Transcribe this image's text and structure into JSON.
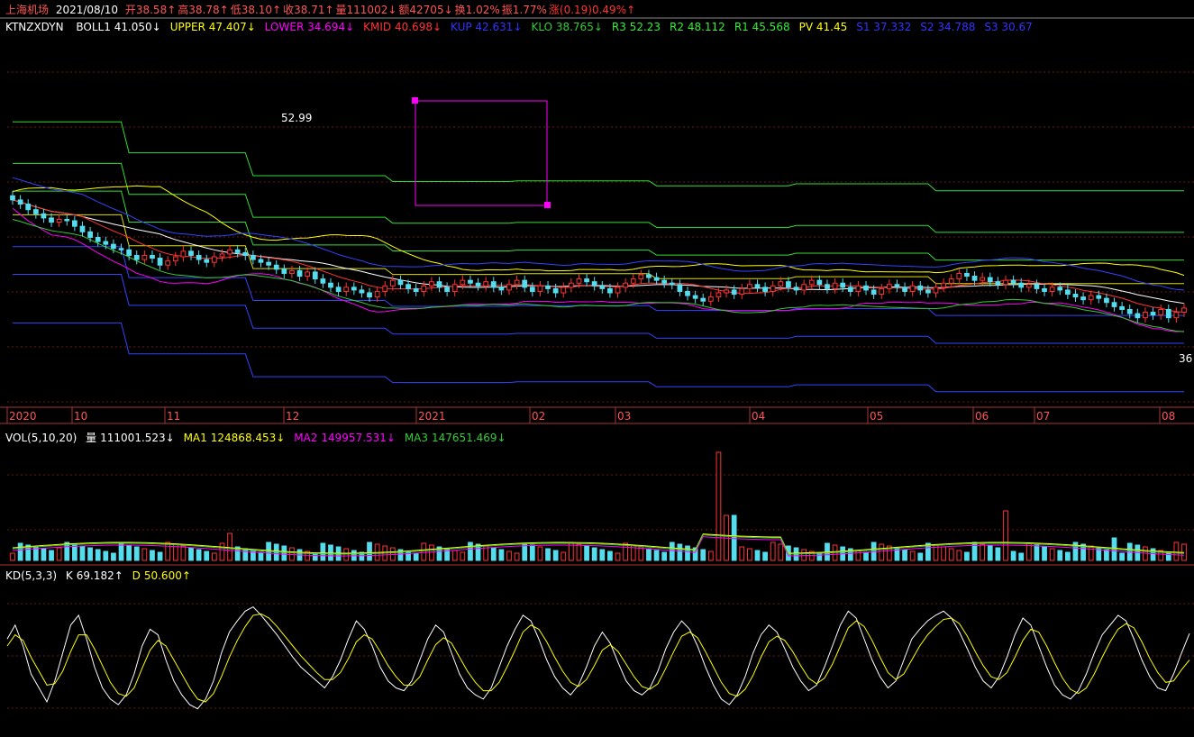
{
  "header": {
    "stock_name": "上海机场",
    "date": "2021/08/10",
    "fields": [
      {
        "text": "开38.58↑",
        "color": "#ff5555"
      },
      {
        "text": "高38.78↑",
        "color": "#ff5555"
      },
      {
        "text": "低38.10↑",
        "color": "#ff5555"
      },
      {
        "text": "收38.71↑",
        "color": "#ff5555"
      },
      {
        "text": "量111002↓",
        "color": "#ff5555"
      },
      {
        "text": "额42705↓",
        "color": "#ff5555"
      },
      {
        "text": "换1.02%",
        "color": "#ff5555"
      },
      {
        "text": "振1.77%",
        "color": "#ff5555"
      },
      {
        "text": "涨(0.19)0.49%↑",
        "color": "#ff3333"
      }
    ]
  },
  "indicator_line": {
    "name": "KTNZXDYN",
    "items": [
      {
        "text": "BOLL1 41.050↓",
        "color": "#ffffff"
      },
      {
        "text": "UPPER 47.407↓",
        "color": "#ffff00"
      },
      {
        "text": "LOWER 34.694↓",
        "color": "#ff00ff"
      },
      {
        "text": "KMID 40.698↓",
        "color": "#ff3333"
      },
      {
        "text": "KUP 42.631↓",
        "color": "#3333ff"
      },
      {
        "text": "KLO 38.765↓",
        "color": "#33cc33"
      },
      {
        "text": "R3 52.23",
        "color": "#33ee33"
      },
      {
        "text": "R2 48.112",
        "color": "#33ee33"
      },
      {
        "text": "R1 45.568",
        "color": "#33ee33"
      },
      {
        "text": "PV 41.45",
        "color": "#ffff00"
      },
      {
        "text": "S1 37.332",
        "color": "#3333ff"
      },
      {
        "text": "S2 34.788",
        "color": "#3333ff"
      },
      {
        "text": "S3 30.67",
        "color": "#3333ff"
      }
    ]
  },
  "chart_data": [
    {
      "type": "candlestick",
      "title": "上海机场",
      "annotations": [
        {
          "text": "52.99",
          "x": "2020-11"
        },
        {
          "text": "36",
          "x": "2021-08"
        }
      ],
      "x_labels": [
        "2020",
        "10",
        "11",
        "12",
        "2021",
        "02",
        "03",
        "04",
        "05",
        "06",
        "07",
        "08"
      ],
      "closes": [
        44.5,
        44.2,
        43.8,
        43.5,
        43.2,
        42.9,
        43.1,
        43.0,
        42.6,
        42.2,
        41.8,
        41.5,
        41.3,
        41.0,
        40.9,
        40.5,
        40.2,
        40.5,
        40.3,
        39.8,
        40.1,
        40.4,
        40.8,
        40.5,
        40.2,
        40.0,
        40.4,
        40.6,
        40.9,
        40.7,
        40.5,
        40.2,
        40.0,
        39.8,
        39.5,
        39.2,
        39.4,
        39.0,
        39.3,
        38.8,
        38.5,
        38.2,
        37.9,
        38.2,
        38.0,
        37.8,
        37.5,
        37.9,
        38.3,
        38.7,
        38.4,
        38.1,
        37.9,
        38.3,
        38.6,
        38.2,
        37.9,
        38.4,
        38.7,
        38.5,
        38.3,
        38.6,
        38.2,
        38.0,
        38.4,
        38.7,
        38.2,
        37.9,
        38.3,
        38.1,
        37.8,
        38.2,
        38.5,
        38.8,
        38.6,
        38.3,
        38.1,
        37.8,
        38.2,
        38.5,
        38.8,
        39.1,
        38.9,
        38.7,
        38.5,
        38.4,
        37.9,
        37.6,
        37.4,
        37.2,
        37.5,
        37.8,
        38.0,
        37.7,
        38.1,
        38.4,
        38.2,
        37.9,
        38.3,
        38.6,
        38.2,
        38.0,
        38.4,
        38.7,
        38.4,
        38.1,
        38.5,
        38.2,
        37.9,
        38.3,
        38.0,
        37.7,
        38.1,
        38.4,
        38.2,
        37.9,
        38.3,
        38.0,
        37.8,
        38.2,
        38.5,
        38.8,
        39.2,
        39.0,
        38.7,
        38.9,
        38.6,
        38.4,
        38.7,
        38.5,
        38.2,
        38.4,
        38.1,
        37.9,
        38.2,
        38.0,
        37.7,
        37.5,
        37.3,
        37.6,
        37.4,
        37.1,
        36.8,
        36.6,
        36.3,
        36.0,
        36.4,
        36.2,
        36.6,
        36.0,
        36.4,
        36.7
      ],
      "kline_points": "",
      "volume": {
        "label": "量",
        "value": "111001.523↓"
      }
    },
    {
      "type": "bar",
      "title": "VOL(5,10,20)",
      "series": [
        {
          "name": "量",
          "value": "111001.523↓"
        },
        {
          "name": "MA1",
          "value": "124868.453↓"
        },
        {
          "name": "MA2",
          "value": "149957.531↓"
        },
        {
          "name": "MA3",
          "value": "147651.469↓"
        }
      ]
    },
    {
      "type": "line",
      "title": "KD(5,3,3)",
      "series": [
        {
          "name": "K",
          "value": "69.182↑"
        },
        {
          "name": "D",
          "value": "50.600↑"
        }
      ],
      "ylim": [
        0,
        100
      ],
      "k_values": [
        65,
        75,
        60,
        40,
        30,
        20,
        35,
        55,
        75,
        82,
        65,
        45,
        30,
        22,
        18,
        25,
        40,
        60,
        72,
        68,
        50,
        35,
        25,
        18,
        15,
        22,
        35,
        55,
        70,
        78,
        85,
        88,
        82,
        75,
        68,
        60,
        52,
        45,
        40,
        35,
        30,
        38,
        50,
        65,
        78,
        72,
        60,
        45,
        35,
        30,
        28,
        35,
        50,
        65,
        75,
        70,
        55,
        40,
        30,
        25,
        22,
        30,
        45,
        60,
        72,
        82,
        78,
        65,
        50,
        38,
        30,
        25,
        32,
        45,
        60,
        70,
        62,
        48,
        35,
        28,
        25,
        30,
        42,
        58,
        70,
        78,
        72,
        60,
        45,
        32,
        22,
        18,
        25,
        38,
        55,
        68,
        75,
        70,
        58,
        45,
        35,
        28,
        32,
        45,
        60,
        75,
        85,
        80,
        65,
        50,
        38,
        30,
        35,
        50,
        65,
        72,
        78,
        82,
        85,
        80,
        70,
        58,
        45,
        35,
        30,
        38,
        52,
        68,
        80,
        75,
        60,
        45,
        32,
        25,
        22,
        28,
        40,
        55,
        68,
        75,
        82,
        78,
        65,
        50,
        38,
        30,
        28,
        40,
        55,
        69
      ],
      "d_values": [
        60,
        68,
        64,
        52,
        42,
        32,
        33,
        42,
        56,
        68,
        68,
        58,
        46,
        34,
        26,
        24,
        30,
        44,
        57,
        64,
        60,
        50,
        40,
        30,
        22,
        20,
        26,
        38,
        52,
        64,
        74,
        82,
        83,
        80,
        74,
        67,
        60,
        53,
        47,
        41,
        36,
        36,
        41,
        51,
        63,
        68,
        65,
        56,
        46,
        38,
        32,
        32,
        38,
        50,
        61,
        66,
        62,
        52,
        42,
        34,
        28,
        28,
        34,
        45,
        57,
        70,
        75,
        72,
        63,
        52,
        42,
        34,
        31,
        36,
        46,
        57,
        61,
        56,
        47,
        38,
        31,
        29,
        33,
        44,
        56,
        67,
        70,
        66,
        56,
        45,
        34,
        26,
        24,
        29,
        39,
        52,
        63,
        67,
        64,
        56,
        46,
        37,
        33,
        37,
        47,
        60,
        73,
        78,
        74,
        64,
        52,
        41,
        36,
        40,
        50,
        60,
        68,
        74,
        79,
        80,
        76,
        67,
        56,
        46,
        38,
        36,
        41,
        52,
        64,
        72,
        70,
        60,
        48,
        37,
        29,
        26,
        30,
        40,
        52,
        63,
        72,
        76,
        73,
        63,
        51,
        41,
        34,
        35,
        43,
        50
      ]
    }
  ]
}
